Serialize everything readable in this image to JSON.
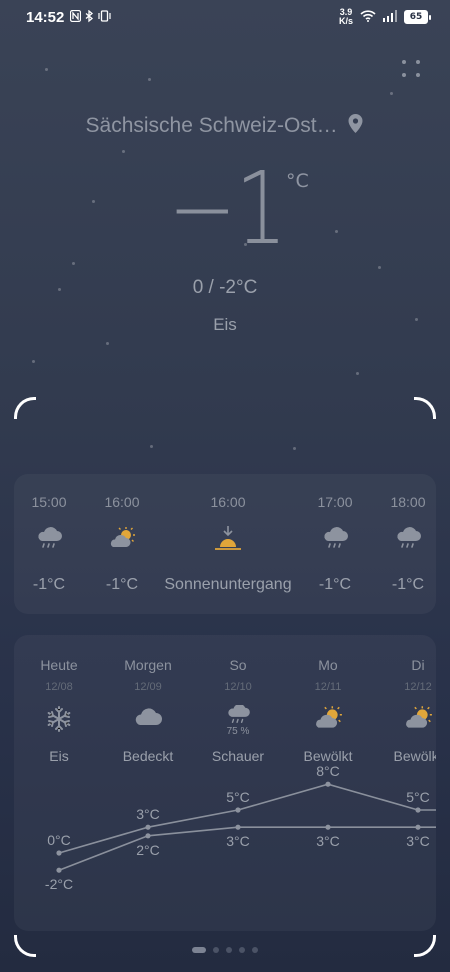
{
  "status_bar": {
    "time": "14:52",
    "net_speed_value": "3.9",
    "net_speed_unit": "K/s",
    "battery": "65"
  },
  "location": {
    "name": "Sächsische Schweiz-Ost…"
  },
  "current": {
    "temp": "−1",
    "unit": "°C",
    "range": "0 / -2°C",
    "condition": "Eis"
  },
  "hourly": [
    {
      "time": "15:00",
      "icon": "rain-cloud-icon",
      "value": "-1°C"
    },
    {
      "time": "16:00",
      "icon": "partly-cloudy-icon",
      "value": "-1°C"
    },
    {
      "time": "16:00",
      "icon": "sunset-icon",
      "value": "Sonnenuntergang"
    },
    {
      "time": "17:00",
      "icon": "rain-cloud-icon",
      "value": "-1°C"
    },
    {
      "time": "18:00",
      "icon": "rain-cloud-icon",
      "value": "-1°C"
    }
  ],
  "daily": [
    {
      "day": "Heute",
      "date": "12/08",
      "icon": "snowflake-icon",
      "condition": "Eis",
      "precip": "",
      "high": 0,
      "low": -2
    },
    {
      "day": "Morgen",
      "date": "12/09",
      "icon": "cloud-icon",
      "condition": "Bedeckt",
      "precip": "",
      "high": 3,
      "low": 2
    },
    {
      "day": "So",
      "date": "12/10",
      "icon": "rain-cloud-icon",
      "condition": "Schauer",
      "precip": "75 %",
      "high": 5,
      "low": 3
    },
    {
      "day": "Mo",
      "date": "12/11",
      "icon": "partly-cloudy-icon",
      "condition": "Bewölkt",
      "precip": "",
      "high": 8,
      "low": 3
    },
    {
      "day": "Di",
      "date": "12/12",
      "icon": "partly-cloudy-icon",
      "condition": "Bewölkt",
      "precip": "",
      "high": 5,
      "low": 3
    }
  ],
  "temp_unit": "°C",
  "colors": {
    "accent_sun": "#e1a63a",
    "line": "#8a909c"
  },
  "pager": {
    "count": 5,
    "active": 0
  }
}
